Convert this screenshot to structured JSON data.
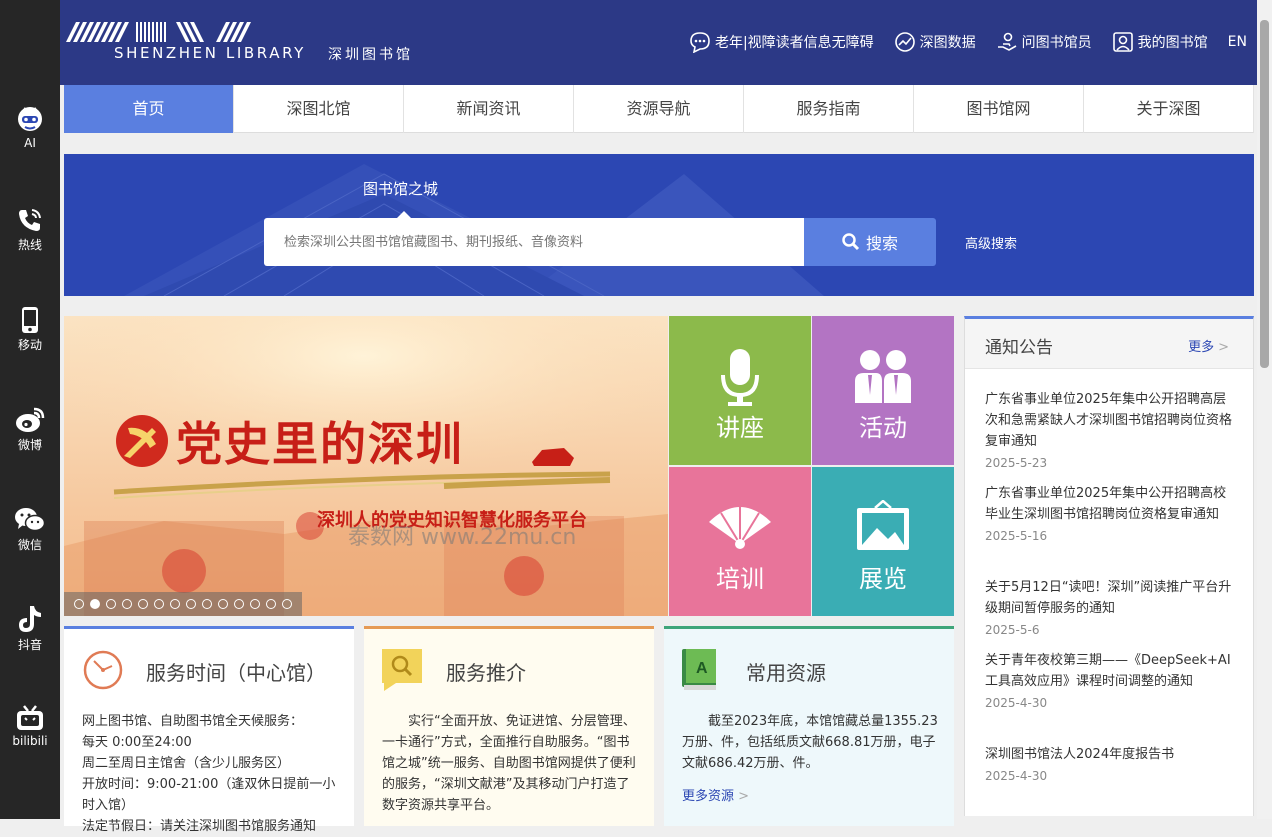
{
  "sidebar": {
    "items": [
      {
        "label": "AI",
        "icon": "robot-icon"
      },
      {
        "label": "热线",
        "icon": "phone-icon"
      },
      {
        "label": "移动",
        "icon": "mobile-icon"
      },
      {
        "label": "微博",
        "icon": "weibo-icon"
      },
      {
        "label": "微信",
        "icon": "wechat-icon"
      },
      {
        "label": "抖音",
        "icon": "douyin-icon"
      },
      {
        "label": "bilibili",
        "icon": "bilibili-icon"
      }
    ]
  },
  "header": {
    "logo_en": "SHENZHEN LIBRARY",
    "logo_zh": "深圳图书馆",
    "links": {
      "accessibility": "老年|视障读者信息无障碍",
      "data": "深图数据",
      "ask": "问图书馆员",
      "my": "我的图书馆",
      "lang": "EN"
    }
  },
  "nav": {
    "items": [
      "首页",
      "深图北馆",
      "新闻资讯",
      "资源导航",
      "服务指南",
      "图书馆网",
      "关于深图"
    ]
  },
  "search": {
    "label": "图书馆之城",
    "placeholder": "检索深圳公共图书馆馆藏图书、期刊报纸、音像资料",
    "button": "搜索",
    "advanced": "高级搜索"
  },
  "banner": {
    "title": "党史里的深圳",
    "subtitle": "深圳人的党史知识智慧化服务平台",
    "watermark": "泰数网 www.22mu.cn",
    "slide_count": 14,
    "active_slide": 2
  },
  "tiles": [
    {
      "label": "讲座",
      "color": "#8cba4b",
      "icon": "microphone-icon"
    },
    {
      "label": "活动",
      "color": "#b374c3",
      "icon": "people-icon"
    },
    {
      "label": "培训",
      "color": "#e8749a",
      "icon": "fan-icon"
    },
    {
      "label": "展览",
      "color": "#3aadb4",
      "icon": "picture-frame-icon"
    }
  ],
  "notice": {
    "title": "通知公告",
    "more": "更多",
    "items": [
      {
        "text": "广东省事业单位2025年集中公开招聘高层次和急需紧缺人才深圳图书馆招聘岗位资格复审通知",
        "date": "2025-5-23"
      },
      {
        "text": "广东省事业单位2025年集中公开招聘高校毕业生深圳图书馆招聘岗位资格复审通知",
        "date": "2025-5-16"
      },
      {
        "text": "关于5月12日“读吧！深圳”阅读推广平台升级期间暂停服务的通知",
        "date": "2025-5-6"
      },
      {
        "text": "关于青年夜校第三期——《DeepSeek+AI工具高效应用》课程时间调整的通知",
        "date": "2025-4-30"
      },
      {
        "text": "深圳图书馆法人2024年度报告书",
        "date": "2025-4-30"
      }
    ]
  },
  "cards": {
    "hours": {
      "title": "服务时间（中心馆）",
      "accent": "#5a7fe0",
      "lines": [
        "网上图书馆、自助图书馆全天候服务：",
        "每天 0:00至24:00",
        "周二至周日主馆舍（含少儿服务区）",
        "开放时间：9:00-21:00（逢双休日提前一小时入馆）",
        "法定节假日：请关注深圳图书馆服务通知"
      ]
    },
    "promo": {
      "title": "服务推介",
      "accent": "#e59a55",
      "body": "实行“全面开放、免证进馆、分层管理、一卡通行”方式，全面推行自助服务。“图书馆之城”统一服务、自助图书馆网提供了便利的服务，“深圳文献港”及其移动门户打造了数字资源共享平台。"
    },
    "resources": {
      "title": "常用资源",
      "accent": "#3fa57a",
      "body": "截至2023年底，本馆馆藏总量1355.23万册、件，包括纸质文献668.81万册，电子文献686.42万册、件。",
      "more": "更多资源"
    }
  }
}
